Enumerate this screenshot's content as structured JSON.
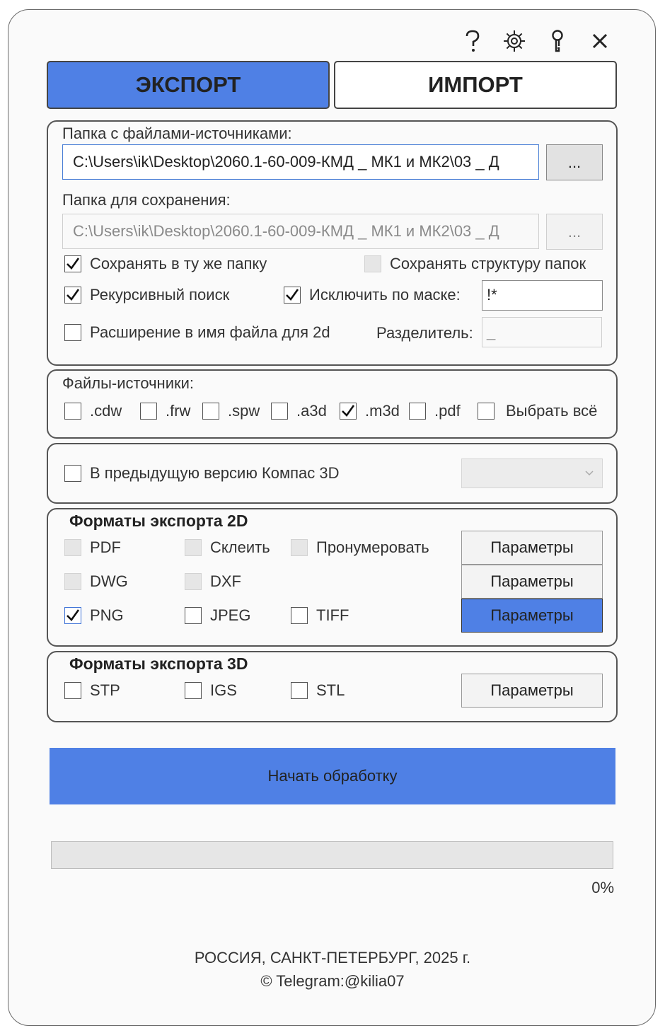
{
  "window": {
    "icons": [
      "help-icon",
      "settings-gear-icon",
      "key-icon",
      "close-icon"
    ]
  },
  "tabs": {
    "export": "ЭКСПОРТ",
    "import": "ИМПОРТ",
    "active": "export"
  },
  "paths": {
    "source_label": "Папка с файлами-источниками:",
    "source_value": "C:\\Users\\ik\\Desktop\\2060.1-60-009-КМД _ МК1 и МК2\\03 _ Д",
    "browse": "...",
    "save_label": "Папка для сохранения:",
    "save_value": "C:\\Users\\ik\\Desktop\\2060.1-60-009-КМД _ МК1 и МК2\\03 _ Д",
    "same_folder": {
      "label": "Сохранять в ту же папку",
      "checked": true
    },
    "keep_structure": {
      "label": "Сохранять структуру папок",
      "checked": false,
      "disabled": true
    },
    "recursive": {
      "label": "Рекурсивный поиск",
      "checked": true
    },
    "exclude_mask": {
      "label": "Исключить по маске:",
      "checked": true,
      "value": "!*"
    },
    "ext_in_name": {
      "label": "Расширение в имя файла для 2d",
      "checked": false
    },
    "separator_label": "Разделитель:",
    "separator_value": "_"
  },
  "sources": {
    "label": "Файлы-источники:",
    "types": [
      {
        "label": ".cdw",
        "checked": false
      },
      {
        "label": ".frw",
        "checked": false
      },
      {
        "label": ".spw",
        "checked": false
      },
      {
        "label": ".a3d",
        "checked": false
      },
      {
        "label": ".m3d",
        "checked": true
      },
      {
        "label": ".pdf",
        "checked": false
      }
    ],
    "select_all": {
      "label": "Выбрать всё",
      "checked": false
    }
  },
  "version": {
    "label": "В предыдущую версию Компас 3D",
    "checked": false,
    "dropdown_value": ""
  },
  "export2d": {
    "title": "Форматы экспорта 2D",
    "pdf": {
      "label": "PDF",
      "checked": false,
      "disabled": true
    },
    "merge": {
      "label": "Склеить",
      "checked": false,
      "disabled": true
    },
    "number": {
      "label": "Пронумеровать",
      "checked": false,
      "disabled": true
    },
    "dwg": {
      "label": "DWG",
      "checked": false,
      "disabled": true
    },
    "dxf": {
      "label": "DXF",
      "checked": false,
      "disabled": true
    },
    "png": {
      "label": "PNG",
      "checked": true
    },
    "jpeg": {
      "label": "JPEG",
      "checked": false
    },
    "tiff": {
      "label": "TIFF",
      "checked": false
    },
    "params": "Параметры"
  },
  "export3d": {
    "title": "Форматы экспорта 3D",
    "stp": {
      "label": "STP",
      "checked": false
    },
    "igs": {
      "label": "IGS",
      "checked": false
    },
    "stl": {
      "label": "STL",
      "checked": false
    },
    "params": "Параметры"
  },
  "start_button": "Начать обработку",
  "progress": {
    "value": 0,
    "text": "0%"
  },
  "footer": {
    "line1": "РОССИЯ, САНКТ-ПЕТЕРБУРГ, 2025 г.",
    "line2": "© Telegram:@kilia07"
  },
  "colors": {
    "accent": "#4f80e5",
    "border": "#555555",
    "disabled": "#e6e6e6"
  }
}
